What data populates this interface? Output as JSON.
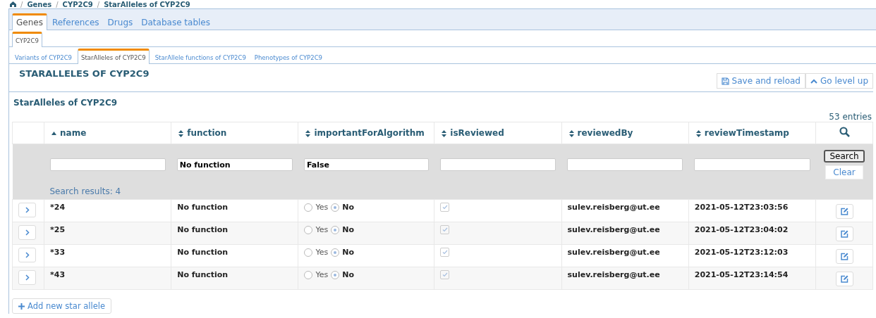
{
  "breadcrumb": [
    {
      "separator": "/",
      "label": "Genes"
    },
    {
      "separator": "/",
      "label": "CYP2C9"
    },
    {
      "separator": "/",
      "label": "StarAlleles of CYP2C9"
    }
  ],
  "tabs": [
    {
      "label": "Genes",
      "selected": true
    },
    {
      "label": "References",
      "selected": false
    },
    {
      "label": "Drugs",
      "selected": false
    },
    {
      "label": "Database tables",
      "selected": false
    }
  ],
  "gene_tabs": [
    {
      "label": "CYP2C9",
      "selected": true
    }
  ],
  "sub_tabs": [
    {
      "label": "Variants of CYP2C9",
      "selected": false
    },
    {
      "label": "StarAlleles of CYP2C9",
      "selected": true
    },
    {
      "label": "StarAllele functions of CYP2C9",
      "selected": false
    },
    {
      "label": "Phenotypes of CYP2C9",
      "selected": false
    }
  ],
  "page_title": "STARALLELES OF CYP2C9",
  "actions": [
    "Save and reload",
    "Go level up"
  ],
  "section_title": "StarAlleles of CYP2C9",
  "entries": "53 entries",
  "columns": [
    {
      "label": "name",
      "sorted": true
    },
    {
      "label": "function",
      "sorted": false,
      "filter": "No function"
    },
    {
      "label": "importantForAlgorithm",
      "sorted": false,
      "filter": "False"
    },
    {
      "label": "isReviewed",
      "sorted": false
    },
    {
      "label": "reviewedBy",
      "sorted": false
    },
    {
      "label": "reviewTimestamp",
      "sorted": false
    }
  ],
  "search_button": "Search",
  "clear_button": "Clear",
  "search_results": "Search results: 4",
  "rows": [
    {
      "name": "*24",
      "function": "No function",
      "important": false,
      "yes": "Yes",
      "no": "No",
      "reviewed": true,
      "reviewed_by": "sulev.reisberg@ut.ee",
      "timestamp": "2021-05-12T23:03:56"
    },
    {
      "name": "*25",
      "function": "No function",
      "important": false,
      "yes": "Yes",
      "no": "No",
      "reviewed": true,
      "reviewed_by": "sulev.reisberg@ut.ee",
      "timestamp": "2021-05-12T23:04:02"
    },
    {
      "name": "*33",
      "function": "No function",
      "important": false,
      "yes": "Yes",
      "no": "No",
      "reviewed": true,
      "reviewed_by": "sulev.reisberg@ut.ee",
      "timestamp": "2021-05-12T23:12:03"
    },
    {
      "name": "*43",
      "function": "No function",
      "important": false,
      "yes": "Yes",
      "no": "No",
      "reviewed": true,
      "reviewed_by": "sulev.reisberg@ut.ee",
      "timestamp": "2021-05-12T23:14:54"
    }
  ],
  "add_button": "Add new star allele"
}
